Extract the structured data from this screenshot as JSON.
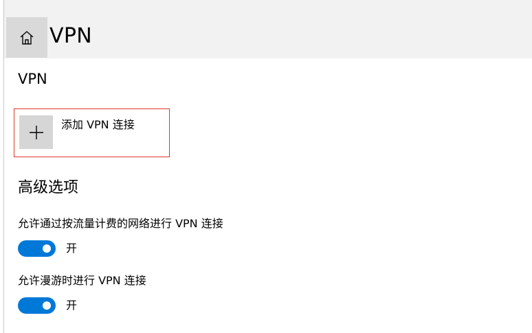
{
  "header": {
    "title": "VPN",
    "home_icon": "home-icon"
  },
  "vpn_section": {
    "heading": "VPN",
    "add_connection_label": "添加 VPN 连接",
    "add_icon": "plus-icon",
    "highlight_color": "#e0332c"
  },
  "advanced": {
    "heading": "高级选项",
    "settings": [
      {
        "label": "允许通过按流量计费的网络进行 VPN 连接",
        "state_label": "开",
        "on": true
      },
      {
        "label": "允许漫游时进行 VPN 连接",
        "state_label": "开",
        "on": true
      }
    ]
  },
  "colors": {
    "accent": "#0078d7",
    "header_bg": "#f2f2f2",
    "home_button_bg": "#d9d9d9",
    "add_tile_bg": "#d6d6d6"
  }
}
